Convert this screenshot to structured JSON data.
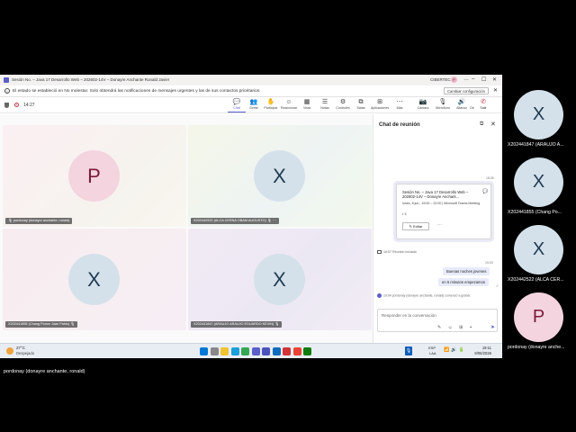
{
  "window": {
    "title": "Sesión No. – Java 17 Desarrollo Web – 202602-14V – Donayre Anchante Ronald Javier",
    "user": "CIBERTEC",
    "avatar_letter": "P",
    "controls": [
      "…",
      "–",
      "☐",
      "✕"
    ]
  },
  "notice": {
    "text": "El estado se estableció en No molestar. Solo obtendrá las notificaciones de mensajes urgentes y las de sus contactos prioritarios.",
    "button_label": "Cambiar configuración",
    "close": "✕"
  },
  "meeting": {
    "elapsed": "14:27",
    "toolbar": [
      {
        "key": "chat",
        "icon": "💬",
        "label": "Chat",
        "active": true
      },
      {
        "key": "gente",
        "icon": "👥",
        "label": "Gente",
        "active": false
      },
      {
        "key": "participar",
        "icon": "✋",
        "label": "Participar",
        "active": false
      },
      {
        "key": "reaccionar",
        "icon": "☺",
        "label": "Reaccionar",
        "active": false
      },
      {
        "key": "vista",
        "icon": "▦",
        "label": "Vista",
        "active": false
      },
      {
        "key": "notas",
        "icon": "☰",
        "label": "Notas",
        "active": false
      },
      {
        "key": "controles",
        "icon": "⚙",
        "label": "Controles",
        "active": false
      },
      {
        "key": "salas",
        "icon": "⧉",
        "label": "Salas",
        "active": false
      },
      {
        "key": "aplicaciones",
        "icon": "⊞",
        "label": "Aplicaciones",
        "active": false
      },
      {
        "key": "mas",
        "icon": "⋯",
        "label": "Más",
        "active": false
      },
      {
        "key": "camara",
        "icon": "📷",
        "label": "Cámara",
        "active": false
      },
      {
        "key": "microfono",
        "icon": "🎙",
        "label": "Micrófono",
        "active": false
      },
      {
        "key": "altavoz",
        "icon": "🔊",
        "label": "Altavoz",
        "active": false
      },
      {
        "key": "dejar",
        "icon": "⬆",
        "label": "Dejar de co...",
        "active": false
      }
    ],
    "leave_label": "Salir",
    "leave_icon": "✆"
  },
  "participants": [
    {
      "initial": "P",
      "name": "pordonay (donayre anchante, ronald)",
      "color": "pink"
    },
    {
      "initial": "X",
      "name": "X202442522 (ALCA CERNA OBAM AUGUSTO)",
      "color": "blue"
    },
    {
      "initial": "X",
      "name": "X202441855 (Chang Ponce Juan Pablo)",
      "color": "blue"
    },
    {
      "initial": "X",
      "name": "X202441847 (ARAUJO ARAUJO EDUARDO KEVIN)",
      "color": "blue"
    }
  ],
  "chat": {
    "title": "Chat de reunión",
    "timestamp_1": "18:05",
    "card": {
      "title": "Sesión No. – Java 17 Desarrollo Web – 202602-14V – Donayre Anchant...",
      "meta": "lunes, 8 jun., 19:00 – 22:00 | Microsoft Teams Meeting",
      "people_count": "3",
      "edit_label": "Editar",
      "more": "⋯"
    },
    "system_message": "18:57  Reunión iniciada",
    "timestamp_2": "19:03",
    "messages": [
      "Buenas noches jovenes",
      "en 5 minutos empezamos"
    ],
    "join_message": "19:04  pordonay (donayre anchante, ronald) comenzó a grabar.",
    "compose_placeholder": "Responder en la conversación",
    "compose_tools": "✎ ☺ ⊞ +"
  },
  "taskbar": {
    "temperature": "27°C",
    "weather": "Despejado",
    "lang_1": "ESP",
    "lang_2": "LAA",
    "time": "19:11",
    "date": "8/06/2026",
    "apps": [
      {
        "key": "start",
        "color": "#0078d4"
      },
      {
        "key": "search",
        "color": "#888888"
      },
      {
        "key": "explorer",
        "color": "#f2c230"
      },
      {
        "key": "edge",
        "color": "#1a9fd8"
      },
      {
        "key": "chrome",
        "color": "#34a853"
      },
      {
        "key": "store",
        "color": "#5b5fc7"
      },
      {
        "key": "teams",
        "color": "#4b53bc"
      },
      {
        "key": "outlook",
        "color": "#0f6cbd"
      },
      {
        "key": "office",
        "color": "#d13438"
      },
      {
        "key": "chrome2",
        "color": "#ea4335"
      },
      {
        "key": "other",
        "color": "#107c10"
      }
    ]
  },
  "side_participants": [
    {
      "initial": "X",
      "name": "X202441847 (ARAUJO A..."
    },
    {
      "initial": "X",
      "name": "X202441855 (Chang Po..."
    },
    {
      "initial": "X",
      "name": "X202442522 (ALCA CER..."
    },
    {
      "initial": "P",
      "name": "pordonay (donayre anche..."
    }
  ],
  "caption": "pordonay (donayre anchante, ronald)"
}
